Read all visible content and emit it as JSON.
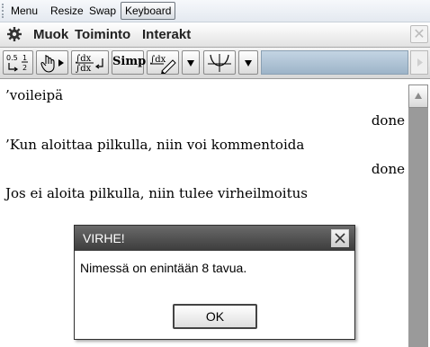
{
  "menubar": {
    "items": [
      "Menu",
      "Resize",
      "Swap",
      "Keyboard"
    ]
  },
  "appmenu": {
    "icon": "gear-icon",
    "items": [
      "Muok",
      "Toiminto",
      "Interakt"
    ],
    "close_icon": "close-icon"
  },
  "toolbar": {
    "buttons": [
      {
        "name": "fraction-decimal-toggle-button",
        "icon": "fraction-decimal-icon",
        "label": ""
      },
      {
        "name": "execute-button",
        "icon": "hand-play-icon",
        "label": ""
      },
      {
        "name": "integral-button",
        "icon": "integral-fraction-icon",
        "label": ""
      },
      {
        "name": "simplify-button",
        "icon": "",
        "label": "Simp"
      },
      {
        "name": "integral-edit-button",
        "icon": "integral-pencil-icon",
        "label": ""
      },
      {
        "name": "dropdown-button-1",
        "icon": "triangle-down-icon",
        "label": ""
      },
      {
        "name": "graph-button",
        "icon": "graph-axes-icon",
        "label": ""
      },
      {
        "name": "dropdown-button-2",
        "icon": "triangle-down-icon",
        "label": ""
      }
    ],
    "scroll_right_icon": "triangle-right-icon"
  },
  "content": {
    "lines": [
      {
        "input": "’voileipä",
        "result": "done"
      },
      {
        "input": "’Kun aloittaa pilkulla, niin voi kommentoida",
        "result": "done"
      },
      {
        "input": "Jos ei aloita pilkulla, niin tulee virheilmoitus",
        "result": ""
      }
    ]
  },
  "scrollbar": {
    "up_icon": "triangle-up-icon"
  },
  "dialog": {
    "title": "VIRHE!",
    "message": "Nimessä on enintään 8 tavua.",
    "ok_label": "OK",
    "close_icon": "close-icon"
  },
  "colors": {
    "dialog_title_bg": "#4a4a4a",
    "scrollbar": "#9a9a9a",
    "toolbar_strip": "#b3c7d9"
  }
}
